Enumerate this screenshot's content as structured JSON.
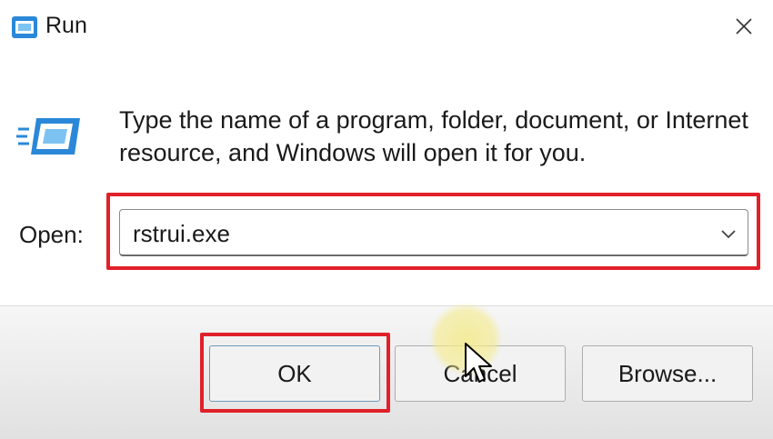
{
  "dialog": {
    "title": "Run",
    "close_icon": "close-icon",
    "app_icon": "run-icon",
    "description": "Type the name of a program, folder, document, or Internet resource, and Windows will open it for you.",
    "open_label": "Open:",
    "open_value": "rstrui.exe",
    "dropdown_icon": "chevron-down-icon"
  },
  "buttons": {
    "ok": "OK",
    "cancel": "Cancel",
    "browse": "Browse..."
  },
  "highlight_color": "#e0202a",
  "cursor_halo_color": "#f5eb8c"
}
